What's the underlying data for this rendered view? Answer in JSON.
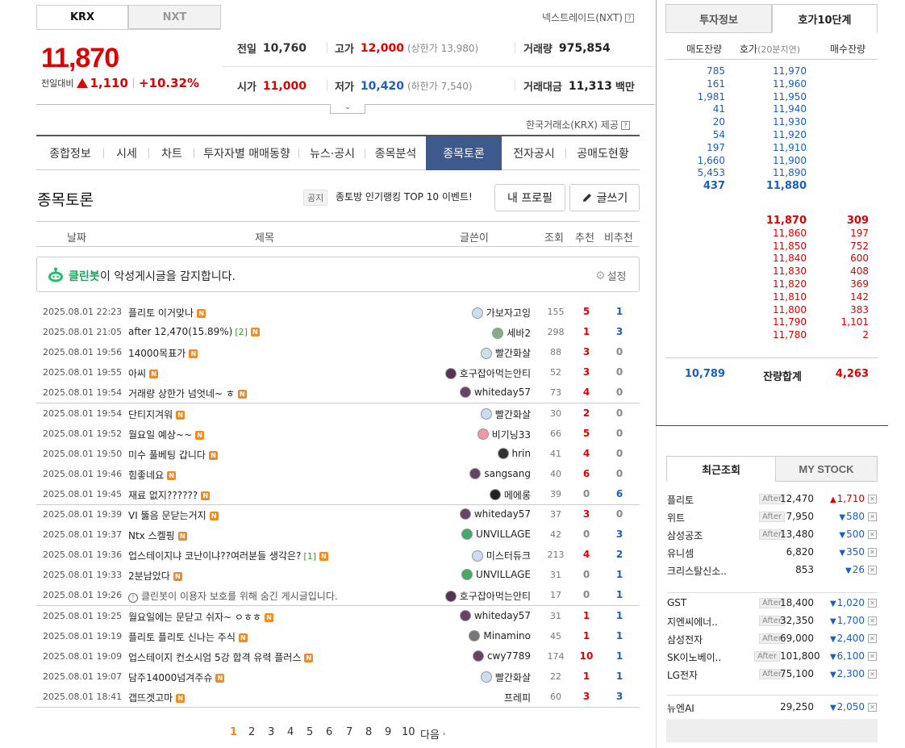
{
  "market_tabs": [
    "KRX",
    "NXT"
  ],
  "nextrade_label": "넥스트레이드(NXT)",
  "quote": {
    "price": "11,870",
    "prev_label": "전일대비",
    "change": "1,110",
    "change_pct": "+10.32%",
    "prev_close_label": "전일",
    "prev_close": "10,760",
    "high_label": "고가",
    "high": "12,000",
    "upper_limit": "(상한가 13,980)",
    "volume_label": "거래량",
    "volume": "975,854",
    "open_label": "시가",
    "open": "11,000",
    "low_label": "저가",
    "low": "10,420",
    "lower_limit": "(하한가 7,540)",
    "amount_label": "거래대금",
    "amount": "11,313",
    "amount_unit": "백만"
  },
  "provider": "한국거래소(KRX) 제공",
  "nav_tabs": [
    "종합정보",
    "시세",
    "차트",
    "투자자별 매매동향",
    "뉴스·공시",
    "종목분석",
    "종목토론",
    "전자공시",
    "공매도현황"
  ],
  "board": {
    "title": "종목토론",
    "notice_tag": "공지",
    "notice": "종토방 인기랭킹 TOP 10 이벤트!",
    "profile_btn": "내 프로필",
    "write_btn": "글쓰기",
    "headers": {
      "date": "날짜",
      "title": "제목",
      "writer": "글쓴이",
      "views": "조회",
      "up": "추천",
      "down": "비추천"
    },
    "cleanbot_name": "클린봇",
    "cleanbot_text": "이 악성게시글을 감지합니다.",
    "settings": "설정",
    "rows": [
      {
        "date": "2025.08.01 22:23",
        "title": "플리토 이거맞나",
        "writer": "가보자고잉",
        "views": "155",
        "up": "5",
        "down": "1"
      },
      {
        "date": "2025.08.01 21:05",
        "title": "after 12,470(15.89%)",
        "cnt": "[2]",
        "writer": "세바2",
        "views": "298",
        "up": "1",
        "down": "3"
      },
      {
        "date": "2025.08.01 19:56",
        "title": "14000목표가",
        "writer": "빨간화살",
        "views": "88",
        "up": "3",
        "down": "0"
      },
      {
        "date": "2025.08.01 19:55",
        "title": "아씨",
        "writer": "호구잡아먹는안티",
        "views": "52",
        "up": "3",
        "down": "0"
      },
      {
        "date": "2025.08.01 19:54",
        "title": "거래량 상한가 넘엇네~ ㅎ",
        "writer": "whiteday57",
        "views": "73",
        "up": "4",
        "down": "0"
      },
      {
        "date": "2025.08.01 19:54",
        "title": "단티지겨워",
        "writer": "빨간화살",
        "views": "30",
        "up": "2",
        "down": "0"
      },
      {
        "date": "2025.08.01 19:52",
        "title": "월요일 예상~~",
        "writer": "비기닝33",
        "views": "66",
        "up": "5",
        "down": "0"
      },
      {
        "date": "2025.08.01 19:50",
        "title": "미수 풀베팅 갑니다",
        "writer": "hrin",
        "views": "41",
        "up": "4",
        "down": "0"
      },
      {
        "date": "2025.08.01 19:46",
        "title": "힘좋네요",
        "writer": "sangsang",
        "views": "40",
        "up": "6",
        "down": "0"
      },
      {
        "date": "2025.08.01 19:45",
        "title": "재료 없지??????",
        "writer": "메에롱",
        "views": "39",
        "up": "0",
        "down": "6"
      },
      {
        "date": "2025.08.01 19:39",
        "title": "VI 뚫음 문닫는거지",
        "writer": "whiteday57",
        "views": "37",
        "up": "3",
        "down": "0"
      },
      {
        "date": "2025.08.01 19:37",
        "title": "Ntx 스켈핑",
        "writer": "UNVILLAGE",
        "views": "42",
        "up": "0",
        "down": "3"
      },
      {
        "date": "2025.08.01 19:36",
        "title": "업스테이지냐 코난이냐??여러분들 생각은?",
        "cnt": "[1]",
        "writer": "미스터듀크",
        "views": "213",
        "up": "4",
        "down": "2"
      },
      {
        "date": "2025.08.01 19:33",
        "title": "2분남았다",
        "writer": "UNVILLAGE",
        "views": "31",
        "up": "0",
        "down": "1"
      },
      {
        "date": "2025.08.01 19:26",
        "title": "클린봇이 이용자 보호를 위해 숨긴 게시글입니다.",
        "hidden": true,
        "writer": "호구잡아먹는안티",
        "views": "17",
        "up": "0",
        "down": "1"
      },
      {
        "date": "2025.08.01 19:25",
        "title": "월요일에는 문닫고 쉬자~ ㅇㅎㅎ",
        "writer": "whiteday57",
        "views": "31",
        "up": "1",
        "down": "1"
      },
      {
        "date": "2025.08.01 19:19",
        "title": "플리토 플리토 신나는 주식",
        "writer": "Minamino",
        "views": "45",
        "up": "1",
        "down": "1"
      },
      {
        "date": "2025.08.01 19:09",
        "title": "업스테이지 컨소시엄 5강 합격 유력 플러스",
        "writer": "cwy7789",
        "views": "174",
        "up": "10",
        "down": "1"
      },
      {
        "date": "2025.08.01 19:07",
        "title": "담주14000넘겨주슈",
        "writer": "빨간화살",
        "views": "22",
        "up": "1",
        "down": "1"
      },
      {
        "date": "2025.08.01 18:41",
        "title": "갭뜨겟고마",
        "writer": "프레피",
        "views": "60",
        "up": "3",
        "down": "3"
      }
    ],
    "pages": [
      "1",
      "2",
      "3",
      "4",
      "5",
      "6",
      "7",
      "8",
      "9",
      "10"
    ],
    "next": "다음"
  },
  "right_tabs": [
    "투자정보",
    "호가10단계"
  ],
  "orderbook": {
    "headers": {
      "sell": "매도잔량",
      "price": "호가",
      "delay": "(20분지연)",
      "buy": "매수잔량"
    },
    "asks": [
      {
        "q": "785",
        "p": "11,970"
      },
      {
        "q": "161",
        "p": "11,960"
      },
      {
        "q": "1,981",
        "p": "11,950"
      },
      {
        "q": "41",
        "p": "11,940"
      },
      {
        "q": "20",
        "p": "11,930"
      },
      {
        "q": "54",
        "p": "11,920"
      },
      {
        "q": "197",
        "p": "11,910"
      },
      {
        "q": "1,660",
        "p": "11,900"
      },
      {
        "q": "5,453",
        "p": "11,890"
      },
      {
        "q": "437",
        "p": "11,880"
      }
    ],
    "bids": [
      {
        "p": "11,870",
        "q": "309"
      },
      {
        "p": "11,860",
        "q": "197"
      },
      {
        "p": "11,850",
        "q": "752"
      },
      {
        "p": "11,840",
        "q": "600"
      },
      {
        "p": "11,830",
        "q": "408"
      },
      {
        "p": "11,820",
        "q": "369"
      },
      {
        "p": "11,810",
        "q": "142"
      },
      {
        "p": "11,800",
        "q": "383"
      },
      {
        "p": "11,790",
        "q": "1,101"
      },
      {
        "p": "11,780",
        "q": "2"
      }
    ],
    "total_sell": "10,789",
    "total_label": "잔량합계",
    "total_buy": "4,263"
  },
  "recent_tabs": [
    "최근조회",
    "MY STOCK"
  ],
  "after_label": "After",
  "recent": [
    {
      "name": "플리토",
      "after": true,
      "price": "12,470",
      "dir": "up",
      "chg": "1,710"
    },
    {
      "name": "위트",
      "after": true,
      "price": "7,950",
      "dir": "down",
      "chg": "580"
    },
    {
      "name": "삼성공조",
      "after": true,
      "price": "13,480",
      "dir": "down",
      "chg": "500"
    },
    {
      "name": "유니셈",
      "after": false,
      "price": "6,820",
      "dir": "down",
      "chg": "350"
    },
    {
      "name": "크리스탈신소..",
      "after": false,
      "price": "853",
      "dir": "down",
      "chg": "26"
    },
    {
      "name": "GST",
      "after": true,
      "price": "18,400",
      "dir": "down",
      "chg": "1,020"
    },
    {
      "name": "지엔씨에너..",
      "after": true,
      "price": "32,350",
      "dir": "down",
      "chg": "1,700"
    },
    {
      "name": "삼성전자",
      "after": true,
      "price": "69,000",
      "dir": "down",
      "chg": "2,400"
    },
    {
      "name": "SK이노베이..",
      "after": true,
      "price": "101,800",
      "dir": "down",
      "chg": "6,100"
    },
    {
      "name": "LG전자",
      "after": true,
      "price": "75,100",
      "dir": "down",
      "chg": "2,300"
    },
    {
      "name": "뉴엔AI",
      "after": false,
      "price": "29,250",
      "dir": "down",
      "chg": "2,050"
    }
  ]
}
